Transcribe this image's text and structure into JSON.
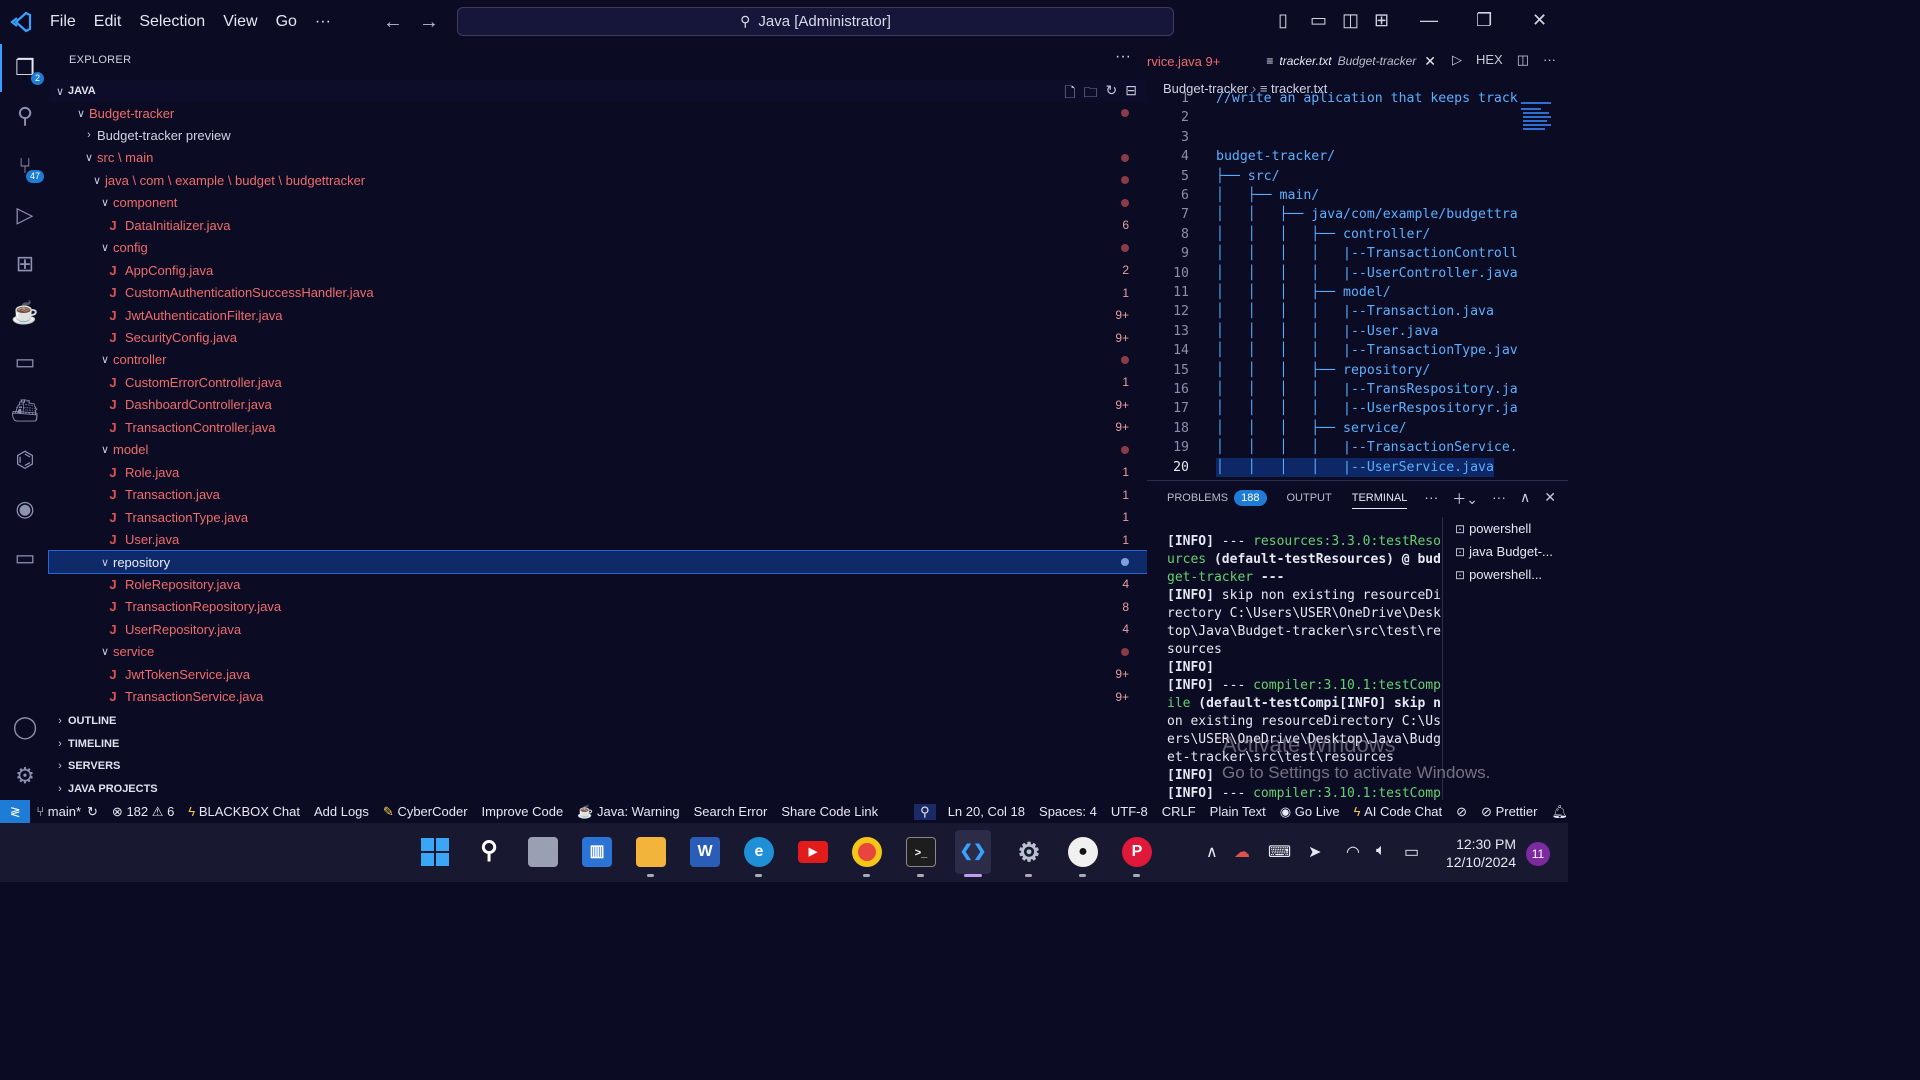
{
  "titlebar": {
    "menus": [
      "File",
      "Edit",
      "Selection",
      "View",
      "Go"
    ],
    "more": "···",
    "search": "Java [Administrator]"
  },
  "activity": {
    "explorer_badge": "2",
    "scm_badge": "47"
  },
  "explorer": {
    "header": "EXPLORER",
    "more": "···",
    "section": "JAVA",
    "tree": [
      {
        "label": "Budget-tracker",
        "indent": 1,
        "type": "folder-open",
        "mark": "dot"
      },
      {
        "label": "Budget-tracker preview",
        "indent": 2,
        "type": "folder-closed-plain",
        "mark": ""
      },
      {
        "label": "src \\ main",
        "indent": 2,
        "type": "folder-open",
        "mark": "dot"
      },
      {
        "label": "java \\ com \\ example \\ budget \\ budgettracker",
        "indent": 3,
        "type": "folder-open",
        "mark": "dot"
      },
      {
        "label": "component",
        "indent": 4,
        "type": "folder-open",
        "mark": "dot"
      },
      {
        "label": "DataInitializer.java",
        "indent": 5,
        "type": "java",
        "mark": "6"
      },
      {
        "label": "config",
        "indent": 4,
        "type": "folder-open",
        "mark": "dot"
      },
      {
        "label": "AppConfig.java",
        "indent": 5,
        "type": "java",
        "mark": "2"
      },
      {
        "label": "CustomAuthenticationSuccessHandler.java",
        "indent": 5,
        "type": "java",
        "mark": "1"
      },
      {
        "label": "JwtAuthenticationFilter.java",
        "indent": 5,
        "type": "java",
        "mark": "9+"
      },
      {
        "label": "SecurityConfig.java",
        "indent": 5,
        "type": "java",
        "mark": "9+"
      },
      {
        "label": "controller",
        "indent": 4,
        "type": "folder-open",
        "mark": "dot"
      },
      {
        "label": "CustomErrorController.java",
        "indent": 5,
        "type": "java",
        "mark": "1"
      },
      {
        "label": "DashboardController.java",
        "indent": 5,
        "type": "java",
        "mark": "9+"
      },
      {
        "label": "TransactionController.java",
        "indent": 5,
        "type": "java",
        "mark": "9+"
      },
      {
        "label": "model",
        "indent": 4,
        "type": "folder-open",
        "mark": "dot"
      },
      {
        "label": "Role.java",
        "indent": 5,
        "type": "java",
        "mark": "1"
      },
      {
        "label": "Transaction.java",
        "indent": 5,
        "type": "java",
        "mark": "1"
      },
      {
        "label": "TransactionType.java",
        "indent": 5,
        "type": "java",
        "mark": "1"
      },
      {
        "label": "User.java",
        "indent": 5,
        "type": "java",
        "mark": "1"
      },
      {
        "label": "repository",
        "indent": 4,
        "type": "folder-open",
        "mark": "dot",
        "selected": true
      },
      {
        "label": "RoleRepository.java",
        "indent": 5,
        "type": "java",
        "mark": "4"
      },
      {
        "label": "TransactionRepository.java",
        "indent": 5,
        "type": "java",
        "mark": "8"
      },
      {
        "label": "UserRepository.java",
        "indent": 5,
        "type": "java",
        "mark": "4"
      },
      {
        "label": "service",
        "indent": 4,
        "type": "folder-open",
        "mark": "dot"
      },
      {
        "label": "JwtTokenService.java",
        "indent": 5,
        "type": "java",
        "mark": "9+"
      },
      {
        "label": "TransactionService.java",
        "indent": 5,
        "type": "java",
        "mark": "9+"
      }
    ],
    "bottom_sections": [
      "OUTLINE",
      "TIMELINE",
      "SERVERS",
      "JAVA PROJECTS"
    ]
  },
  "editor": {
    "tab_inactive": "rvice.java 9+",
    "tab_active": "tracker.txt",
    "tab_active_path": "Budget-tracker",
    "actions": [
      "▷",
      "HEX",
      "◫",
      "···"
    ],
    "breadcrumb_folder": "Budget-tracker",
    "breadcrumb_file": "tracker.txt",
    "lines": [
      {
        "n": "1",
        "t": "//write an aplication that keeps track"
      },
      {
        "n": "2",
        "t": ""
      },
      {
        "n": "3",
        "t": ""
      },
      {
        "n": "4",
        "t": "budget-tracker/"
      },
      {
        "n": "5",
        "t": "├── src/"
      },
      {
        "n": "6",
        "t": "│   ├── main/"
      },
      {
        "n": "7",
        "t": "│   │   ├── java/com/example/budgettra"
      },
      {
        "n": "8",
        "t": "│   │   │   ├── controller/"
      },
      {
        "n": "9",
        "t": "│   │   │   │   |--TransactionControll"
      },
      {
        "n": "10",
        "t": "│   │   │   │   |--UserController.java"
      },
      {
        "n": "11",
        "t": "│   │   │   ├── model/"
      },
      {
        "n": "12",
        "t": "│   │   │   │   |--Transaction.java"
      },
      {
        "n": "13",
        "t": "│   │   │   │   |--User.java"
      },
      {
        "n": "14",
        "t": "│   │   │   │   |--TransactionType.jav"
      },
      {
        "n": "15",
        "t": "│   │   │   ├── repository/"
      },
      {
        "n": "16",
        "t": "│   │   │   │   |--TransRespository.ja"
      },
      {
        "n": "17",
        "t": "│   │   │   │   |--UserRespositoryr.ja"
      },
      {
        "n": "18",
        "t": "│   │   │   ├── service/"
      },
      {
        "n": "19",
        "t": "│   │   │   │   |--TransactionService."
      },
      {
        "n": "20",
        "t": "│   │   │   │   |--UserService.java"
      }
    ]
  },
  "panel": {
    "tabs": {
      "problems": "PROBLEMS",
      "problems_count": "188",
      "output": "OUTPUT",
      "terminal": "TERMINAL"
    },
    "terminal_lines": [
      {
        "tag": "[INFO]",
        "rest": " --- ",
        "green": "resources:3.3.0:testReso",
        "tail": ""
      },
      {
        "tag": "",
        "rest": "",
        "green": "urces",
        "tail": " (default-testResources) @ bud"
      },
      {
        "tag": "",
        "rest": "",
        "green": "get-tracker",
        "tail": " ---"
      },
      {
        "tag": "[INFO]",
        "rest": " skip non existing resourceDi",
        "green": "",
        "tail": ""
      },
      {
        "tag": "",
        "rest": "rectory C:\\Users\\USER\\OneDrive\\Desk",
        "green": "",
        "tail": ""
      },
      {
        "tag": "",
        "rest": "top\\Java\\Budget-tracker\\src\\test\\re",
        "green": "",
        "tail": ""
      },
      {
        "tag": "",
        "rest": "sources",
        "green": "",
        "tail": ""
      },
      {
        "tag": "[INFO]",
        "rest": "",
        "green": "",
        "tail": ""
      },
      {
        "tag": "[INFO]",
        "rest": " --- ",
        "green": "compiler:3.10.1:testComp",
        "tail": ""
      },
      {
        "tag": "",
        "rest": "",
        "green": "ile",
        "tail": " (default-testCompi[INFO] skip n"
      },
      {
        "tag": "",
        "rest": "on existing resourceDirectory C:\\Us",
        "green": "",
        "tail": ""
      },
      {
        "tag": "",
        "rest": "ers\\USER\\OneDrive\\Desktop\\Java\\Budg",
        "green": "",
        "tail": ""
      },
      {
        "tag": "",
        "rest": "et-tracker\\src\\test\\resources",
        "green": "",
        "tail": ""
      },
      {
        "tag": "[INFO]",
        "rest": "",
        "green": "",
        "tail": ""
      },
      {
        "tag": "[INFO]",
        "rest": " --- ",
        "green": "compiler:3.10.1:testComp",
        "tail": ""
      }
    ],
    "terminals": [
      "powershell",
      "java  Budget-...",
      "powershell..."
    ],
    "watermark_title": "Activate Windows",
    "watermark_sub": "Go to Settings to activate Windows."
  },
  "statusbar": {
    "branch": "main*",
    "errors": "182",
    "warnings": "6",
    "items": [
      "BLACKBOX Chat",
      "Add Logs",
      "CyberCoder",
      "Improve Code",
      "Java: Warning",
      "Search Error",
      "Share Code Link"
    ],
    "position": "Ln 20, Col 18",
    "spaces": "Spaces: 4",
    "encoding": "UTF-8",
    "eol": "CRLF",
    "language": "Plain Text",
    "golive": "Go Live",
    "aichat": "AI Code Chat",
    "prettier": "Prettier"
  },
  "taskbar": {
    "time": "12:30 PM",
    "date": "12/10/2024",
    "notifications": "11"
  }
}
